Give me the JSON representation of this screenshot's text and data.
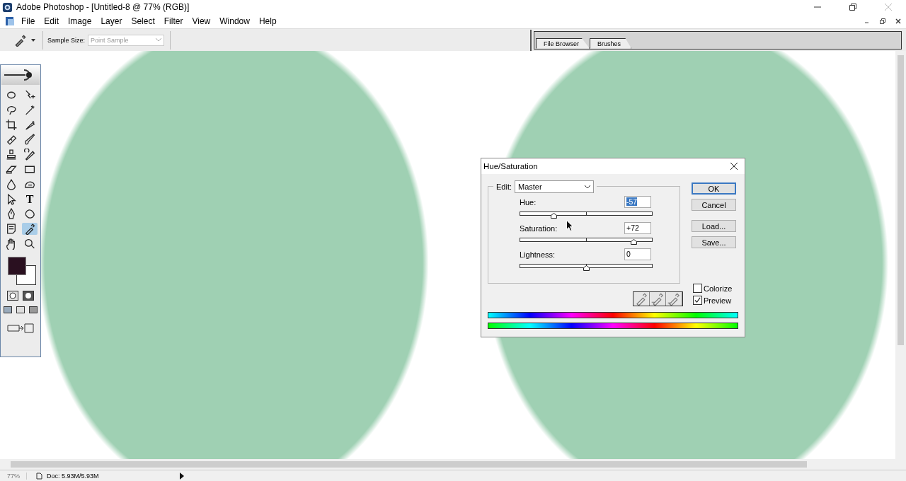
{
  "window": {
    "title": "Adobe Photoshop - [Untitled-8 @ 77% (RGB)]"
  },
  "menu": [
    "File",
    "Edit",
    "Image",
    "Layer",
    "Select",
    "Filter",
    "View",
    "Window",
    "Help"
  ],
  "options_bar": {
    "sample_size_label": "Sample Size:",
    "sample_size_value": "Point Sample",
    "sample_size_disabled": true
  },
  "palette_well": {
    "tabs": [
      {
        "label": "File Browser",
        "selected": false
      },
      {
        "label": "Brushes",
        "selected": false
      }
    ]
  },
  "toolbox": {
    "tools": [
      {
        "selected": false
      },
      {
        "selected": false
      },
      {
        "selected": false
      },
      {
        "selected": false
      },
      {
        "selected": false
      },
      {
        "selected": false
      },
      {
        "selected": false
      },
      {
        "selected": false
      },
      {
        "selected": false
      },
      {
        "selected": false
      },
      {
        "selected": false
      },
      {
        "selected": false
      },
      {
        "selected": false
      },
      {
        "selected": false
      },
      {
        "selected": false
      },
      {
        "selected": false,
        "glyph": "T"
      },
      {
        "selected": false
      },
      {
        "selected": false
      },
      {
        "selected": false
      },
      {
        "selected": true
      },
      {
        "selected": false
      },
      {
        "selected": false
      }
    ]
  },
  "dialog": {
    "title": "Hue/Saturation",
    "edit_label": "Edit:",
    "edit_value": "Master",
    "sliders": [
      {
        "label": "Hue:",
        "value": "-57",
        "selected": true,
        "level": 0.25
      },
      {
        "label": "Saturation:",
        "value": "+72",
        "selected": false,
        "level": 0.86
      },
      {
        "label": "Lightness:",
        "value": "0",
        "selected": false,
        "level": 0.5
      }
    ],
    "buttons": [
      {
        "label": "OK",
        "default": true
      },
      {
        "label": "Cancel",
        "default": false
      },
      {
        "label": "Load...",
        "default": false
      },
      {
        "label": "Save...",
        "default": false
      }
    ],
    "checkboxes": [
      {
        "label": "Colorize",
        "checked": false
      },
      {
        "label": "Preview",
        "checked": true
      }
    ]
  },
  "status_bar": {
    "zoom": "77%",
    "doc": "Doc: 5.93M/5.93M"
  }
}
